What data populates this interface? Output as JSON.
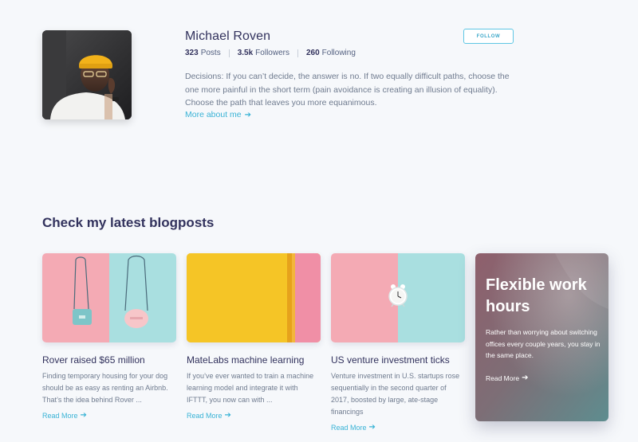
{
  "profile": {
    "name": "Michael Roven",
    "posts_count": "323",
    "posts_label": "Posts",
    "followers_count": "3.5k",
    "followers_label": "Followers",
    "following_count": "260",
    "following_label": "Following",
    "follow_label": "FOLLOW",
    "bio": "Decisions: If you can’t decide, the answer is no. If two equally difficult paths, choose the one more painful in the short term (pain avoidance is creating an illusion of equality). Choose the path that leaves you more equanimous.",
    "more_link": "More about me",
    "arrow_icon": "arrow-right-icon"
  },
  "blog": {
    "section_title": "Check my latest blogposts",
    "posts": [
      {
        "title": "Rover raised $65 million",
        "excerpt": "Finding temporary housing for your dog should be as easy as renting an Airbnb. That’s the idea behind Rover ...",
        "read_more": "Read More"
      },
      {
        "title": "MateLabs machine learning",
        "excerpt": "If you’ve ever wanted to train a machine learning model and integrate it with IFTTT, you now can with ...",
        "read_more": "Read More"
      },
      {
        "title": "US venture investment ticks",
        "excerpt": "Venture investment in U.S. startups rose sequentially in the second quarter of 2017, boosted by large, ate-stage financings",
        "read_more": "Read More"
      }
    ],
    "feature": {
      "title": "Flexible work hours",
      "text": "Rather than worrying about switching offices every couple years, you stay in the same place.",
      "read_more": "Read More"
    }
  },
  "colors": {
    "background": "#f6f8fb",
    "heading": "#32325d",
    "body_text": "#6f7b8f",
    "link": "#3ab3d6",
    "follow_border": "#5ec6e4"
  }
}
